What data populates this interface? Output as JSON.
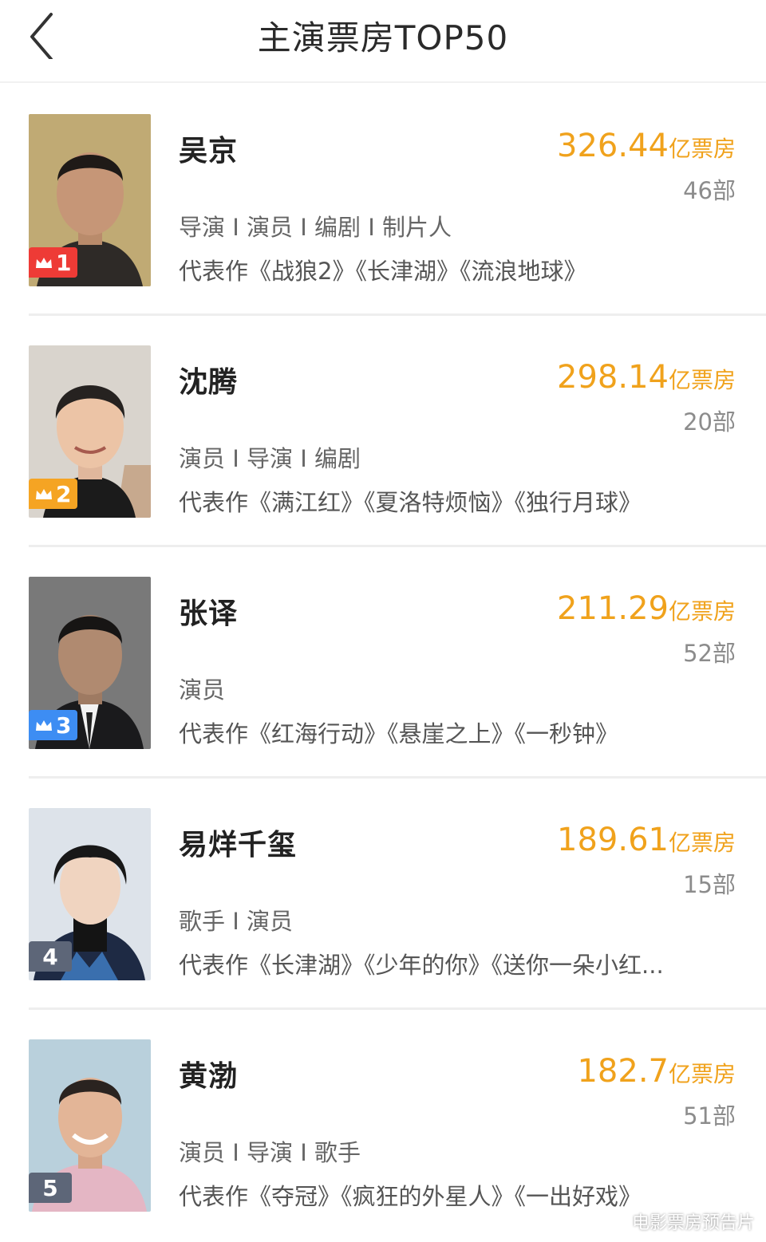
{
  "header": {
    "title": "主演票房TOP50",
    "back_icon": "chevron-left-icon"
  },
  "colors": {
    "box_office": "#f0a21c",
    "rank_1": "#ee3b36",
    "rank_2": "#f5a423",
    "rank_3": "#3d8df3",
    "rank_other": "#5d6678"
  },
  "items": [
    {
      "rank": "1",
      "name": "吴京",
      "box_value": "326.44",
      "box_unit": "亿票房",
      "films": "46部",
      "roles": "导演 I 演员 I 编剧 I 制片人",
      "works": "代表作《战狼2》《长津湖》《流浪地球》"
    },
    {
      "rank": "2",
      "name": "沈腾",
      "box_value": "298.14",
      "box_unit": "亿票房",
      "films": "20部",
      "roles": "演员 I 导演 I 编剧",
      "works": "代表作《满江红》《夏洛特烦恼》《独行月球》"
    },
    {
      "rank": "3",
      "name": "张译",
      "box_value": "211.29",
      "box_unit": "亿票房",
      "films": "52部",
      "roles": "演员",
      "works": "代表作《红海行动》《悬崖之上》《一秒钟》"
    },
    {
      "rank": "4",
      "name": "易烊千玺",
      "box_value": "189.61",
      "box_unit": "亿票房",
      "films": "15部",
      "roles": "歌手 I 演员",
      "works": "代表作《长津湖》《少年的你》《送你一朵小红..."
    },
    {
      "rank": "5",
      "name": "黄渤",
      "box_value": "182.7",
      "box_unit": "亿票房",
      "films": "51部",
      "roles": "演员 I 导演 I 歌手",
      "works": "代表作《夺冠》《疯狂的外星人》《一出好戏》"
    }
  ],
  "watermark": "电影票房预告片"
}
